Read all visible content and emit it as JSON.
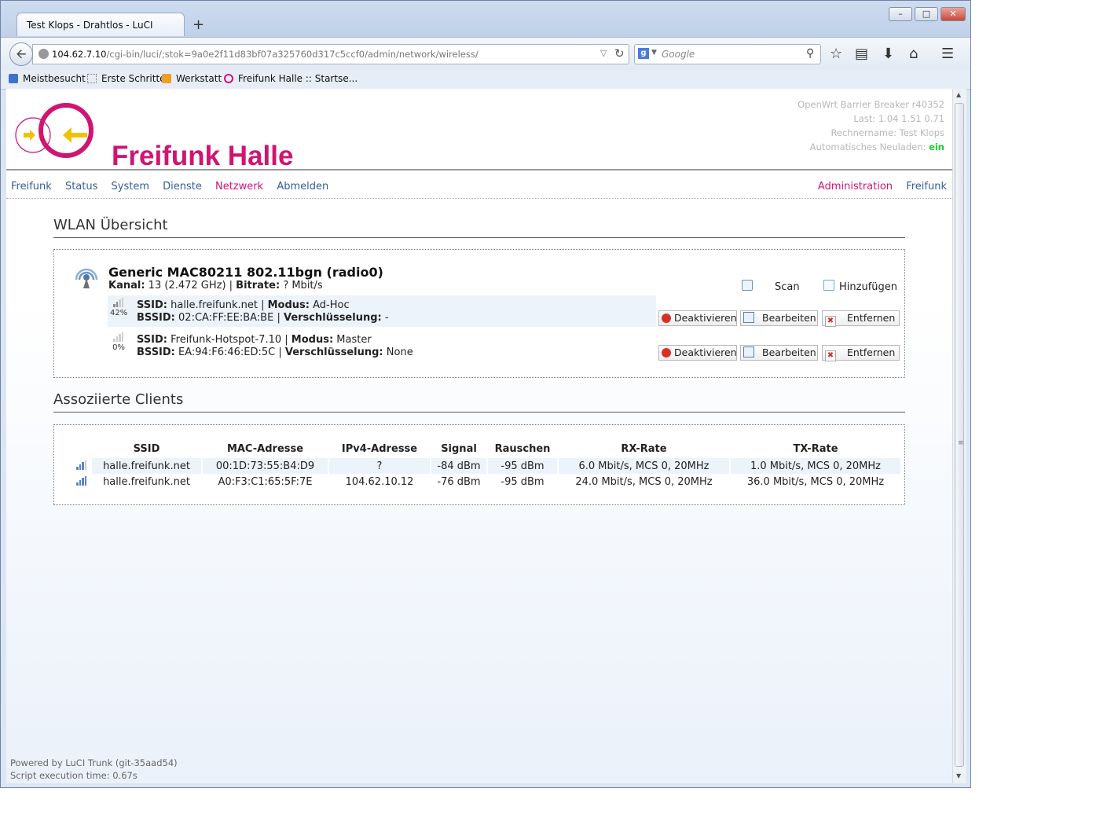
{
  "browser": {
    "tab_title": "Test Klops - Drahtlos - LuCI",
    "new_tab": "+",
    "url_host": "104.62.7.10",
    "url_path": "/cgi-bin/luci/;stok=9a0e2f11d83bf07a325760d317c5ccf0/admin/network/wireless/",
    "search_placeholder": "Google",
    "bookmarks": [
      "Meistbesucht",
      "Erste Schritte",
      "Werkstatt",
      "Freifunk Halle :: Startse..."
    ]
  },
  "header": {
    "title": "Freifunk Halle",
    "sysinfo": {
      "firmware": "OpenWrt Barrier Breaker r40352",
      "load": "Last: 1.04 1.51 0.71",
      "hostname": "Rechnername: Test Klops",
      "autorefresh_label": "Automatisches Neuladen:",
      "autorefresh_value": "ein"
    }
  },
  "menu": {
    "left": [
      "Freifunk",
      "Status",
      "System",
      "Dienste",
      "Netzwerk",
      "Abmelden"
    ],
    "right": [
      "Administration",
      "Freifunk"
    ]
  },
  "wlan": {
    "title": "WLAN Übersicht",
    "radio_name": "Generic MAC80211 802.11bgn (radio0)",
    "kanal_label": "Kanal:",
    "kanal_value": "13 (2.472 GHz)",
    "bitrate_label": "Bitrate:",
    "bitrate_value": "? Mbit/s",
    "scan_label": "Scan",
    "add_label": "Hinzufügen",
    "networks": [
      {
        "signal": "42%",
        "ssid_label": "SSID:",
        "ssid": "halle.freifunk.net",
        "mode_label": "Modus:",
        "mode": "Ad-Hoc",
        "bssid_label": "BSSID:",
        "bssid": "02:CA:FF:EE:BA:BE",
        "enc_label": "Verschlüsselung:",
        "enc": "-"
      },
      {
        "signal": "0%",
        "ssid_label": "SSID:",
        "ssid": "Freifunk-Hotspot-7.10",
        "mode_label": "Modus:",
        "mode": "Master",
        "bssid_label": "BSSID:",
        "bssid": "EA:94:F6:46:ED:5C",
        "enc_label": "Verschlüsselung:",
        "enc": "None"
      }
    ],
    "buttons": {
      "disable": "Deaktivieren",
      "edit": "Bearbeiten",
      "remove": "Entfernen"
    }
  },
  "clients": {
    "title": "Assoziierte Clients",
    "columns": [
      "SSID",
      "MAC-Adresse",
      "IPv4-Adresse",
      "Signal",
      "Rauschen",
      "RX-Rate",
      "TX-Rate"
    ],
    "rows": [
      [
        "halle.freifunk.net",
        "00:1D:73:55:B4:D9",
        "?",
        "-84 dBm",
        "-95 dBm",
        "6.0 Mbit/s, MCS 0, 20MHz",
        "1.0 Mbit/s, MCS 0, 20MHz"
      ],
      [
        "halle.freifunk.net",
        "A0:F3:C1:65:5F:7E",
        "104.62.10.12",
        "-76 dBm",
        "-95 dBm",
        "24.0 Mbit/s, MCS 0, 20MHz",
        "36.0 Mbit/s, MCS 0, 20MHz"
      ]
    ]
  },
  "footer": {
    "powered": "Powered by LuCI Trunk (git-35aad54)",
    "exec_time": "Script execution time: 0.67s"
  },
  "colors": {
    "brand": "#d01471",
    "link": "#365c96",
    "on": "#22cc33"
  }
}
